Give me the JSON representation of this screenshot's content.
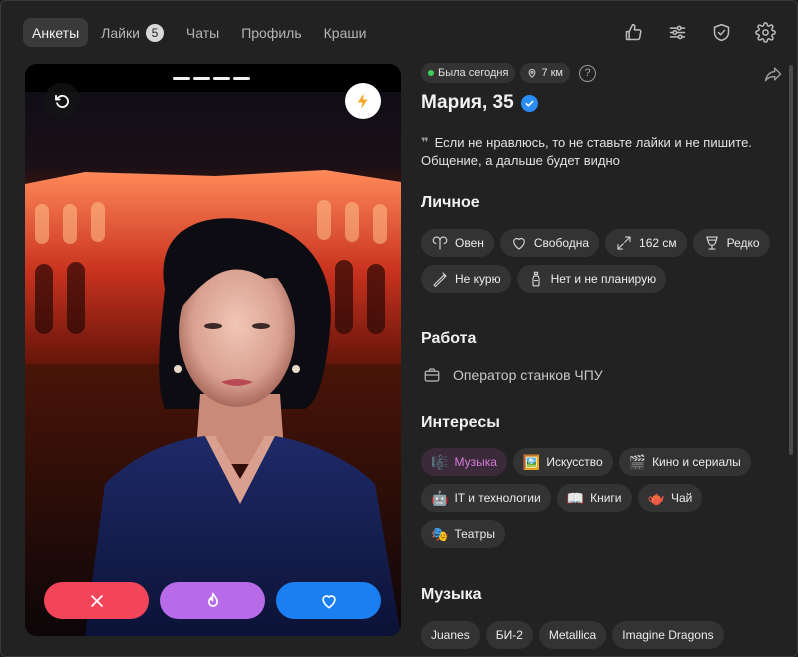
{
  "nav": {
    "tabs": [
      {
        "label": "Анкеты",
        "active": true
      },
      {
        "label": "Лайки",
        "badge": "5"
      },
      {
        "label": "Чаты"
      },
      {
        "label": "Профиль"
      },
      {
        "label": "Краши"
      }
    ],
    "icons": [
      "thumbs-up-icon",
      "filters-icon",
      "shield-check-icon",
      "gear-icon"
    ]
  },
  "photo": {
    "progress_segments": 4
  },
  "profile": {
    "status": "Была сегодня",
    "distance": "7 км",
    "help": "?",
    "name": "Мария, 35",
    "bio": "Если не нравлюсь, то не ставьте лайки и не пишите. Общение, а дальше будет видно"
  },
  "sections": {
    "personal": {
      "title": "Личное",
      "chips": [
        {
          "icon": "zodiac-aries-icon",
          "label": "Овен"
        },
        {
          "icon": "heart-outline-icon",
          "label": "Свободна"
        },
        {
          "icon": "expand-arrows-icon",
          "label": "162 см"
        },
        {
          "icon": "wine-glass-icon",
          "label": "Редко"
        },
        {
          "icon": "no-smoking-icon",
          "label": "Не курю"
        },
        {
          "icon": "baby-bottle-icon",
          "label": "Нет и не планирую"
        }
      ]
    },
    "work": {
      "title": "Работа",
      "value": "Оператор станков ЧПУ"
    },
    "interests": {
      "title": "Интересы",
      "chips": [
        {
          "emoji": "🎼",
          "label": "Музыка",
          "highlighted": true
        },
        {
          "emoji": "🖼️",
          "label": "Искусство"
        },
        {
          "emoji": "🎬",
          "label": "Кино и сериалы"
        },
        {
          "emoji": "🤖",
          "label": "IT и технологии"
        },
        {
          "emoji": "📖",
          "label": "Книги"
        },
        {
          "emoji": "🫖",
          "label": "Чай"
        },
        {
          "emoji": "🎭",
          "label": "Театры"
        }
      ]
    },
    "music": {
      "title": "Музыка",
      "chips": [
        "Juanes",
        "БИ-2",
        "Metallica",
        "Imagine Dragons"
      ]
    }
  },
  "colors": {
    "nope": "#f2455a",
    "super": "#b76be8",
    "like": "#1a7ff0",
    "online": "#3ccf5b",
    "verified": "#2a8cf5",
    "boost": "#f5a623"
  }
}
